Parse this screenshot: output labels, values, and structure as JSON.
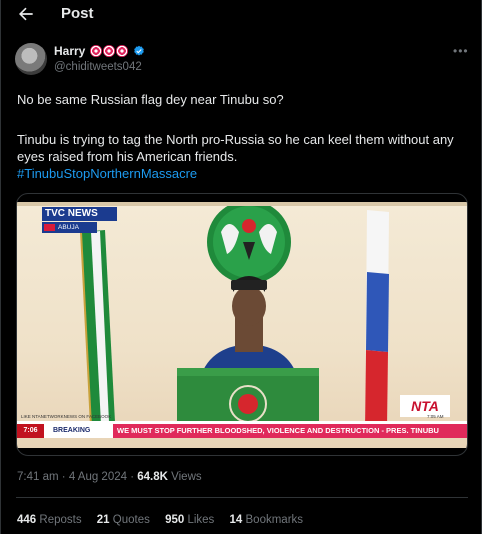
{
  "header": {
    "title": "Post"
  },
  "author": {
    "name": "Harry",
    "handle": "@chiditweets042",
    "emoji_badges": [
      "direct-hit-emoji",
      "direct-hit-emoji",
      "direct-hit-emoji"
    ],
    "verified": true
  },
  "post": {
    "line1": "No be same Russian flag dey near Tinubu so?",
    "line2": "Tinubu is trying to tag the North pro-Russia so he can keel them without any eyes raised from his American friends.",
    "hashtag": "#TinubuStopNorthernMassacre"
  },
  "media": {
    "channel_logo": "TVC NEWS",
    "location_tag": "ABUJA",
    "ticker_time": "7:06",
    "ticker_label": "BREAKING",
    "ticker_text": "WE MUST STOP FURTHER BLOODSHED, VIOLENCE AND DESTRUCTION - PRES. TINUBU",
    "corner_logo": "NTA",
    "small_left": "LIKE NTANETWORKNEWS ON FACEBOOK",
    "small_right": "7:05 AM",
    "colors": {
      "ticker": "#e02a5b",
      "tvc": "#1b3b8f",
      "flag_green": "#1f8a3b"
    }
  },
  "meta": {
    "time": "7:41 am",
    "sep": "·",
    "date": "4 Aug 2024",
    "views_count": "64.8K",
    "views_label": "Views"
  },
  "stats": {
    "reposts_count": "446",
    "reposts_label": "Reposts",
    "quotes_count": "21",
    "quotes_label": "Quotes",
    "likes_count": "950",
    "likes_label": "Likes",
    "bookmarks_count": "14",
    "bookmarks_label": "Bookmarks"
  }
}
